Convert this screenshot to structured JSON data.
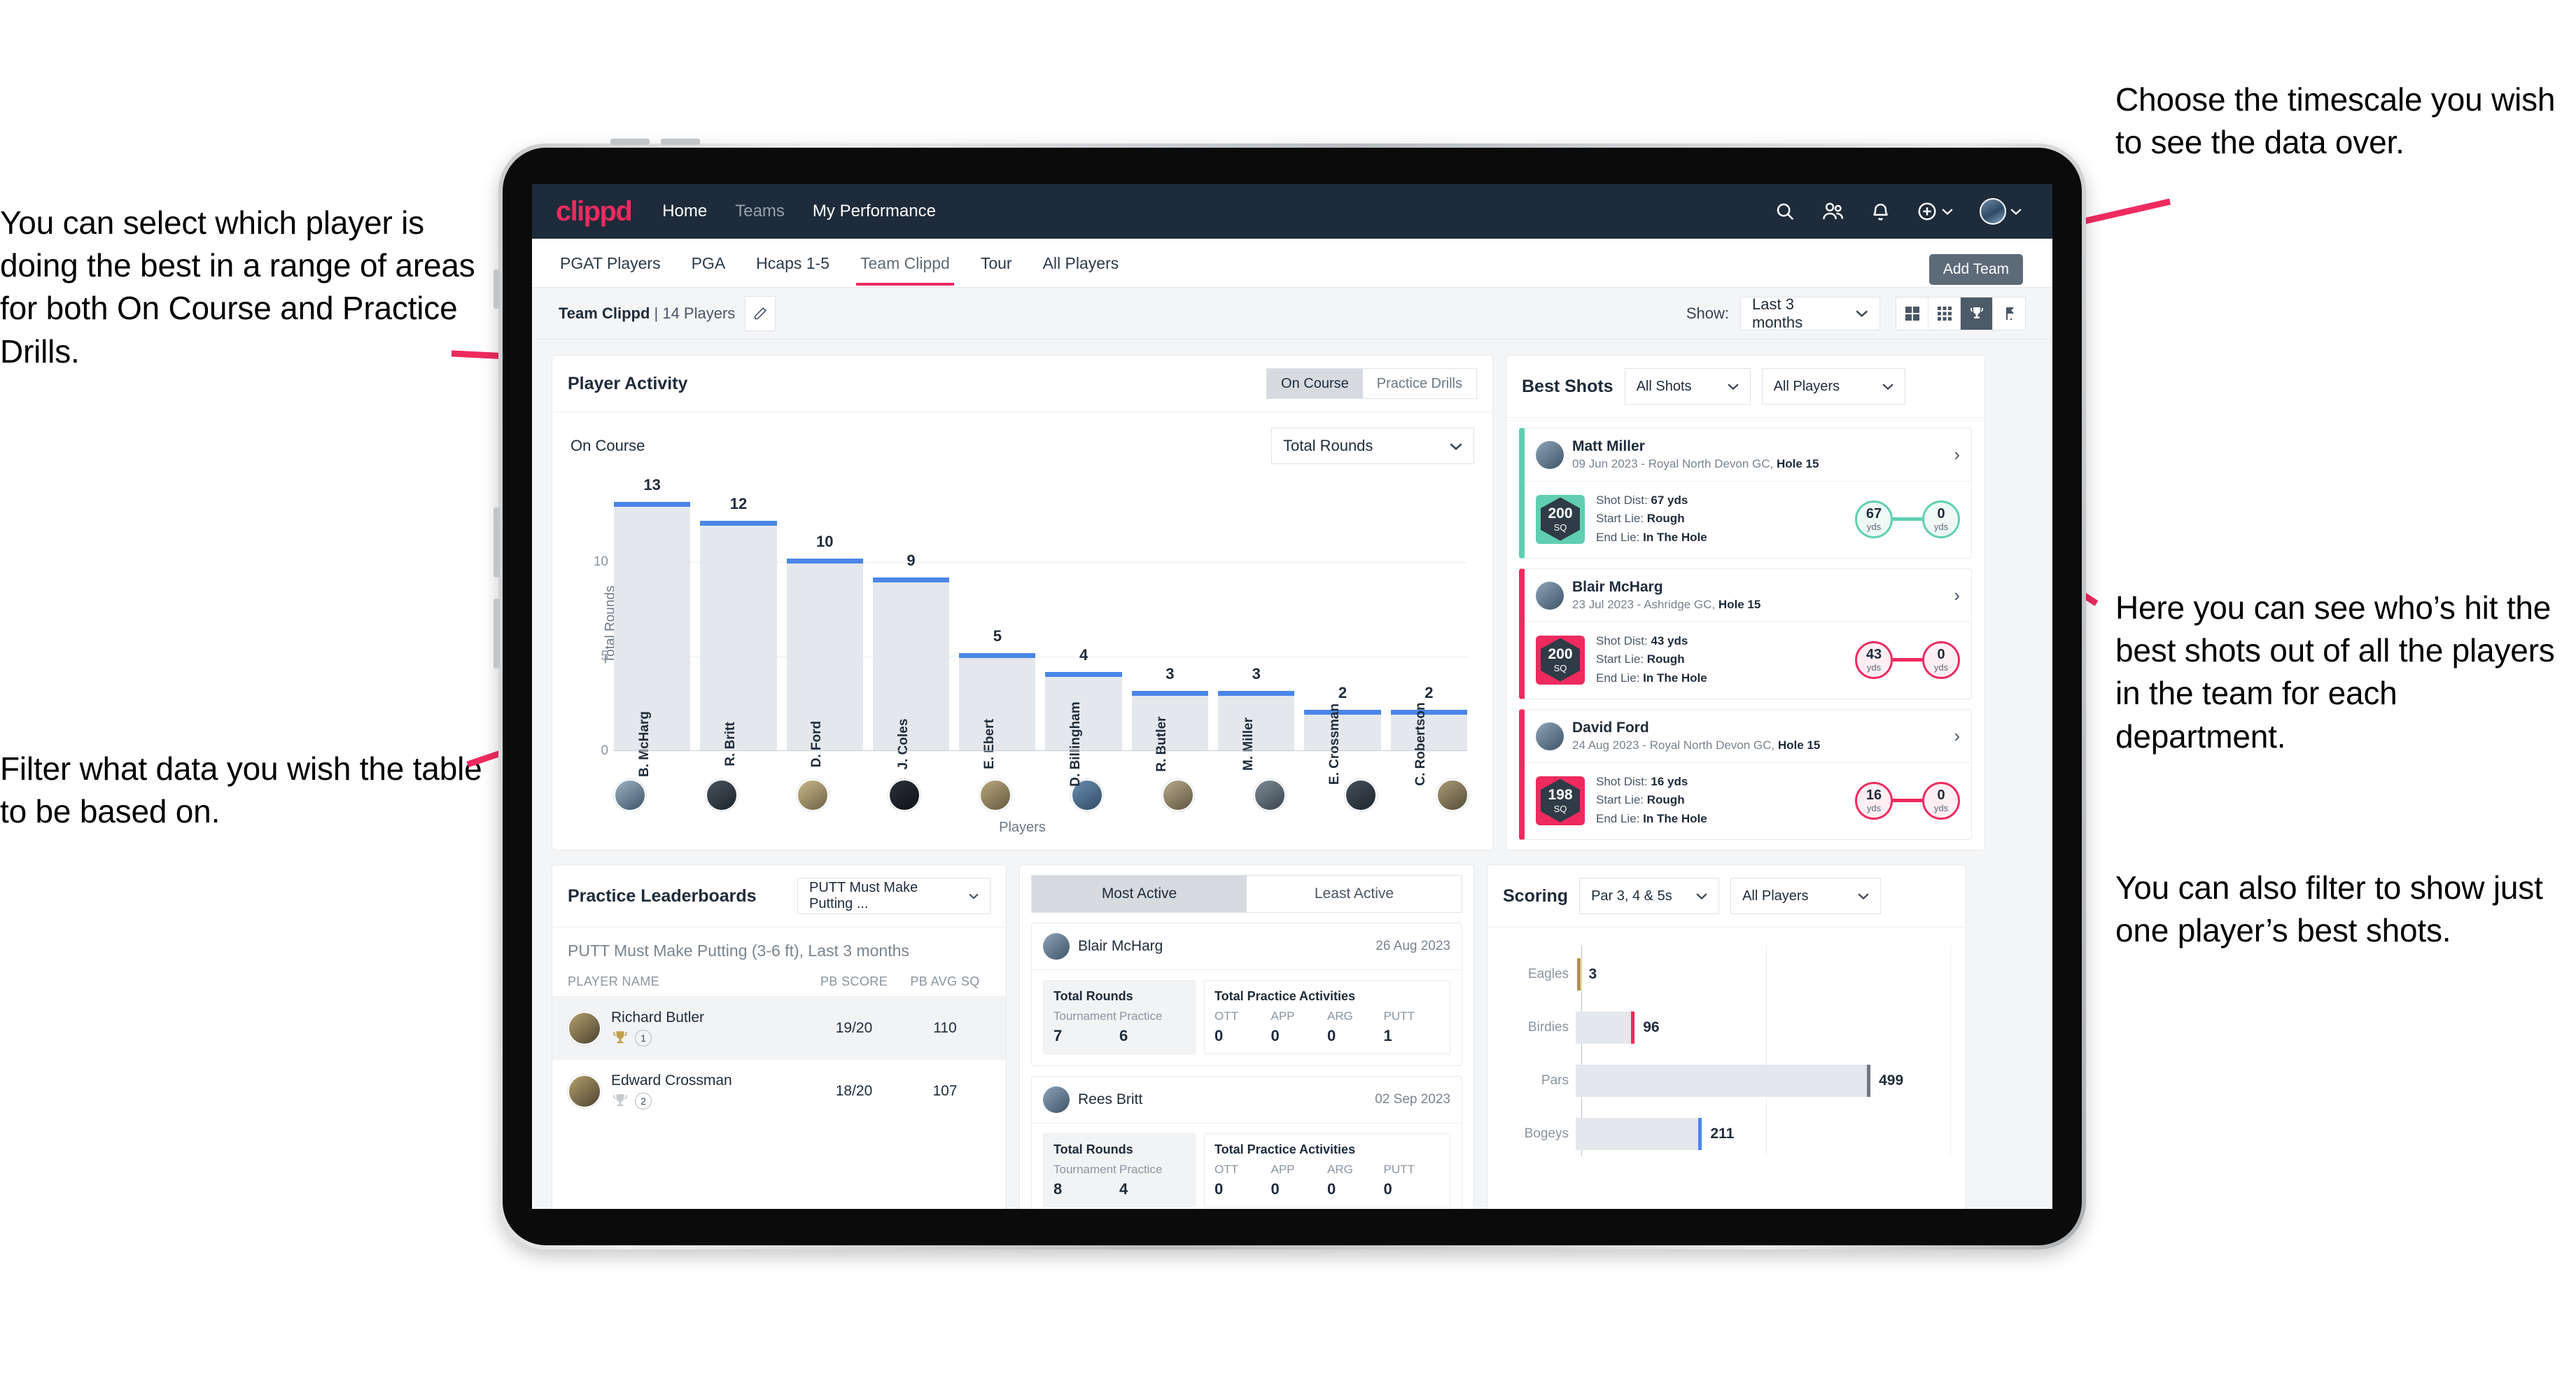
{
  "annotations": {
    "player_select": "You can select which player is doing the best in a range of areas for both On Course and Practice Drills.",
    "filter_table": "Filter what data you wish the table to be based on.",
    "timescale": "Choose the timescale you wish to see the data over.",
    "best_shots": "Here you can see who’s hit the best shots out of all the players in the team for each department.",
    "filter_player": "You can also filter to show just one player’s best shots."
  },
  "navbar": {
    "logo": "clippd",
    "links": [
      {
        "label": "Home",
        "active": true
      },
      {
        "label": "Teams",
        "active": false
      },
      {
        "label": "My Performance",
        "active": true
      }
    ],
    "icons": [
      "search-icon",
      "people-icon",
      "bell-icon",
      "plus-circle-icon",
      "avatar-icon"
    ]
  },
  "subtabs": {
    "items": [
      {
        "label": "PGAT Players"
      },
      {
        "label": "PGA"
      },
      {
        "label": "Hcaps 1-5"
      },
      {
        "label": "Team Clippd"
      },
      {
        "label": "Tour"
      },
      {
        "label": "All Players"
      }
    ],
    "active_index": 3,
    "tooltip": "Add Team"
  },
  "teambar": {
    "team_name": "Team Clippd",
    "team_count": " | 14 Players",
    "show_label": "Show:",
    "timescale_value": "Last 3 months",
    "view_modes": [
      "grid-4-icon",
      "grid-9-icon",
      "trophy-icon",
      "flag-icon"
    ],
    "active_view_index": 2
  },
  "player_activity": {
    "title": "Player Activity",
    "segments": [
      {
        "label": "On Course",
        "active": true
      },
      {
        "label": "Practice Drills",
        "active": false
      }
    ],
    "sub_label": "On Course",
    "metric_select": "Total Rounds"
  },
  "chart_data": [
    {
      "type": "bar",
      "id": "player-activity",
      "title": "Player Activity",
      "xlabel": "Players",
      "ylabel": "Total Rounds",
      "ylim": [
        0,
        14
      ],
      "yticks": [
        0,
        5,
        10
      ],
      "grid": true,
      "categories": [
        "B. McHarg",
        "R. Britt",
        "D. Ford",
        "J. Coles",
        "E. Ebert",
        "D. Billingham",
        "R. Butler",
        "M. Miller",
        "E. Crossman",
        "C. Robertson"
      ],
      "values": [
        13,
        12,
        10,
        9,
        5,
        4,
        3,
        3,
        2,
        2
      ],
      "bar_color": "#e4e7eb",
      "cap_color": "#4a86e8"
    },
    {
      "type": "bar",
      "id": "scoring",
      "orientation": "horizontal",
      "title": "Scoring",
      "categories": [
        "Eagles",
        "Birdies",
        "Pars",
        "Bogeys"
      ],
      "values": [
        3,
        96,
        499,
        211
      ],
      "xlim": [
        0,
        640
      ],
      "grid": true,
      "colors": [
        "#b5913c",
        "#ee2a5f",
        "#6f7680",
        "#4a86e8"
      ]
    }
  ],
  "best_shots": {
    "title": "Best Shots",
    "shot_filter": "All Shots",
    "player_filter": "All Players",
    "cards": [
      {
        "name": "Matt Miller",
        "meta_date": "09 Jun 2023 - Royal North Devon GC, ",
        "meta_hole": "Hole 15",
        "sq_value": "200",
        "sq_unit": "SQ",
        "accent": "#5fcfb0",
        "shot_dist_label": "Shot Dist: ",
        "shot_dist": "67 yds",
        "start_lie_label": "Start Lie: ",
        "start_lie": "Rough",
        "end_lie_label": "End Lie: ",
        "end_lie": "In The Hole",
        "from_value": "67",
        "from_unit": "yds",
        "to_value": "0",
        "to_unit": "yds"
      },
      {
        "name": "Blair McHarg",
        "meta_date": "23 Jul 2023 - Ashridge GC, ",
        "meta_hole": "Hole 15",
        "sq_value": "200",
        "sq_unit": "SQ",
        "accent": "#ee2a5f",
        "shot_dist_label": "Shot Dist: ",
        "shot_dist": "43 yds",
        "start_lie_label": "Start Lie: ",
        "start_lie": "Rough",
        "end_lie_label": "End Lie: ",
        "end_lie": "In The Hole",
        "from_value": "43",
        "from_unit": "yds",
        "to_value": "0",
        "to_unit": "yds"
      },
      {
        "name": "David Ford",
        "meta_date": "24 Aug 2023 - Royal North Devon GC, ",
        "meta_hole": "Hole 15",
        "sq_value": "198",
        "sq_unit": "SQ",
        "accent": "#ee2a5f",
        "shot_dist_label": "Shot Dist: ",
        "shot_dist": "16 yds",
        "start_lie_label": "Start Lie: ",
        "start_lie": "Rough",
        "end_lie_label": "End Lie: ",
        "end_lie": "In The Hole",
        "from_value": "16",
        "from_unit": "yds",
        "to_value": "0",
        "to_unit": "yds"
      }
    ]
  },
  "practice": {
    "title": "Practice Leaderboards",
    "drill_select": "PUTT Must Make Putting ...",
    "subtitle_bold": "PUTT Must Make Putting (3-6 ft),",
    "subtitle_light": " Last 3 months",
    "columns": [
      "PLAYER NAME",
      "PB SCORE",
      "PB AVG SQ"
    ],
    "rows": [
      {
        "name": "Richard Butler",
        "rank": "1",
        "trophy": "gold",
        "pb_score": "19/20",
        "pb_avg_sq": "110"
      },
      {
        "name": "Edward Crossman",
        "rank": "2",
        "trophy": "silver",
        "pb_score": "18/20",
        "pb_avg_sq": "107"
      }
    ]
  },
  "activity": {
    "tabs": [
      {
        "label": "Most Active",
        "active": true
      },
      {
        "label": "Least Active",
        "active": false
      }
    ],
    "cards": [
      {
        "name": "Blair McHarg",
        "date": "26 Aug 2023",
        "rounds_title": "Total Rounds",
        "rounds_keys": [
          "Tournament",
          "Practice"
        ],
        "rounds_values": [
          "7",
          "6"
        ],
        "practice_title": "Total Practice Activities",
        "practice_keys": [
          "OTT",
          "APP",
          "ARG",
          "PUTT"
        ],
        "practice_values": [
          "0",
          "0",
          "0",
          "1"
        ]
      },
      {
        "name": "Rees Britt",
        "date": "02 Sep 2023",
        "rounds_title": "Total Rounds",
        "rounds_keys": [
          "Tournament",
          "Practice"
        ],
        "rounds_values": [
          "8",
          "4"
        ],
        "practice_title": "Total Practice Activities",
        "practice_keys": [
          "OTT",
          "APP",
          "ARG",
          "PUTT"
        ],
        "practice_values": [
          "0",
          "0",
          "0",
          "0"
        ]
      }
    ]
  },
  "scoring": {
    "title": "Scoring",
    "par_filter": "Par 3, 4 & 5s",
    "player_filter": "All Players"
  }
}
